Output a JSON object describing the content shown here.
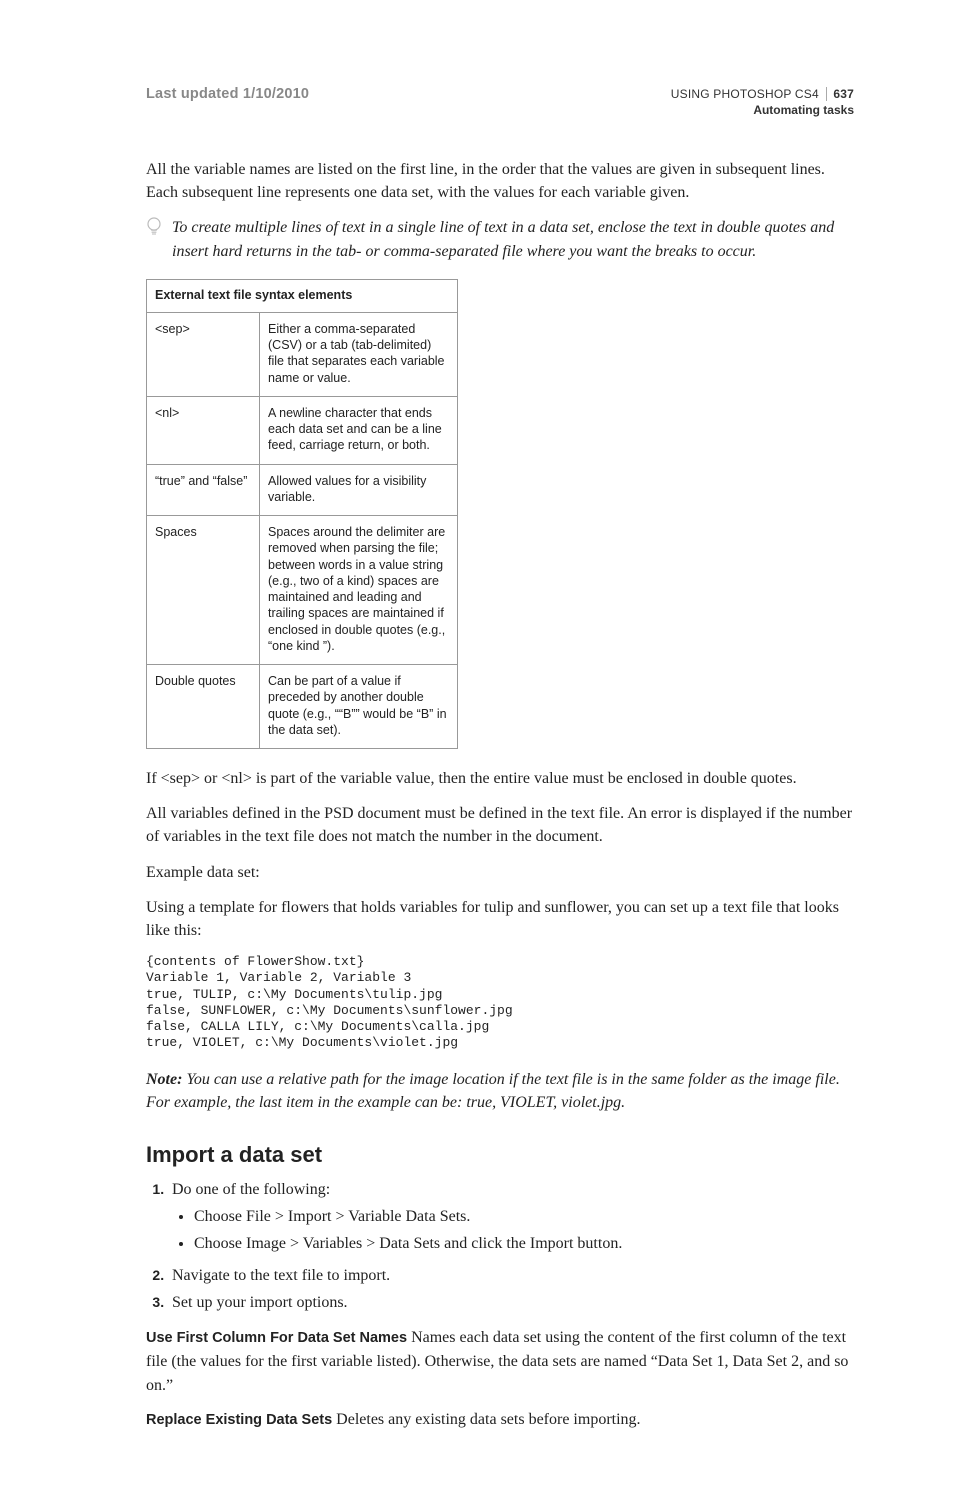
{
  "header": {
    "last_updated": "Last updated 1/10/2010",
    "doc_title": "USING PHOTOSHOP CS4",
    "page_number": "637",
    "section": "Automating tasks"
  },
  "intro_para": "All the variable names are listed on the first line, in the order that the values are given in subsequent lines. Each subsequent line represents one data set, with the values for each variable given.",
  "tip_text": "To create multiple lines of text in a single line of text in a data set, enclose the text in double quotes and insert hard returns in the tab- or comma-separated file where you want the breaks to occur.",
  "table": {
    "title": "External text file syntax elements",
    "rows": [
      {
        "k": "<sep>",
        "v": "Either a comma-separated (CSV) or a tab (tab-delimited) file that separates each variable name or value."
      },
      {
        "k": "<nl>",
        "v": "A newline character that ends each data set and can be a line feed, carriage return, or both."
      },
      {
        "k": "“true” and “false”",
        "v": "Allowed values for a visibility variable."
      },
      {
        "k": "Spaces",
        "v": "Spaces around the delimiter are removed when parsing the file; between words in a value string (e.g., two of a kind) spaces are maintained and leading and trailing spaces are maintained if enclosed in double quotes (e.g., “one kind ”)."
      },
      {
        "k": "Double quotes",
        "v": "Can be part of a value if preceded by another double quote (e.g., ““B”” would be “B” in the data set)."
      }
    ]
  },
  "para_sep": "If <sep> or <nl> is part of the variable value, then the entire value must be enclosed in double quotes.",
  "para_vars": "All variables defined in the PSD document must be defined in the text file. An error is displayed if the number of variables in the text file does not match the number in the document.",
  "para_example_label": "Example data set:",
  "para_template": "Using a template for flowers that holds variables for tulip and sunflower, you can set up a text file that looks like this:",
  "code_block": "{contents of FlowerShow.txt}\nVariable 1, Variable 2, Variable 3\ntrue, TULIP, c:\\My Documents\\tulip.jpg\nfalse, SUNFLOWER, c:\\My Documents\\sunflower.jpg\nfalse, CALLA LILY, c:\\My Documents\\calla.jpg\ntrue, VIOLET, c:\\My Documents\\violet.jpg",
  "note": {
    "label": "Note:",
    "text": " You can use a relative path for the image location if the text file is in the same folder as the image file. For example, the last item in the example can be: true, VIOLET, violet.jpg."
  },
  "import": {
    "heading": "Import a data set",
    "step1": "Do one of the following:",
    "bullet1": "Choose File > Import > Variable Data Sets.",
    "bullet2": "Choose Image > Variables > Data Sets and click the Import button.",
    "step2": "Navigate to the text file to import.",
    "step3": "Set up your import options.",
    "def1_term": "Use First Column For Data Set Names",
    "def1_text": "  Names each data set using the content of the first column of the text file (the values for the first variable listed). Otherwise, the data sets are named “Data Set 1, Data Set 2, and so on.”",
    "def2_term": "Replace Existing Data Sets",
    "def2_text": "  Deletes any existing data sets before importing."
  }
}
